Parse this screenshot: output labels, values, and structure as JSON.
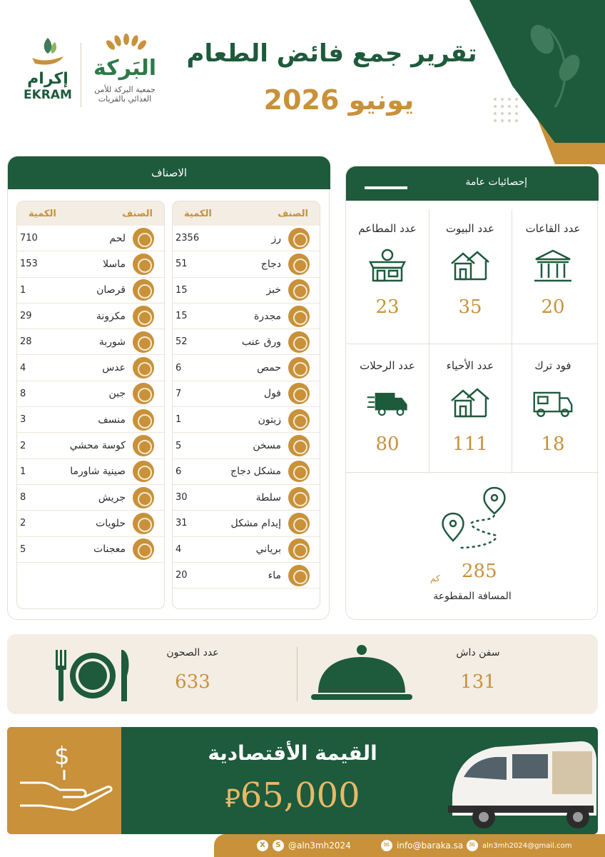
{
  "header": {
    "title": "تقرير جمع فائض الطعام",
    "date": "يونيو 2026",
    "ekram_ar": "إكرام",
    "ekram_en": "EKRAM",
    "baraka_name": "البَركة",
    "baraka_sub1": "جمعية البركة للأمن",
    "baraka_sub2": "الغذائي بالقريات"
  },
  "categories": {
    "title": "الاصناف",
    "col_item": "الصنف",
    "col_qty": "الكمية",
    "right": [
      {
        "name": "رز",
        "qty": "2356",
        "icon": "rice-icon"
      },
      {
        "name": "دجاج",
        "qty": "51",
        "icon": "chicken-icon"
      },
      {
        "name": "خبز",
        "qty": "15",
        "icon": "bread-icon"
      },
      {
        "name": "مجدرة",
        "qty": "15",
        "icon": "mujaddara-icon"
      },
      {
        "name": "ورق عنب",
        "qty": "52",
        "icon": "grape-leaves-icon"
      },
      {
        "name": "حمص",
        "qty": "6",
        "icon": "hummus-icon"
      },
      {
        "name": "فول",
        "qty": "7",
        "icon": "beans-icon"
      },
      {
        "name": "زيتون",
        "qty": "1",
        "icon": "olive-icon"
      },
      {
        "name": "مسخن",
        "qty": "5",
        "icon": "musakhan-icon"
      },
      {
        "name": "مشكل دجاج",
        "qty": "6",
        "icon": "mixed-chicken-icon"
      },
      {
        "name": "سلطة",
        "qty": "30",
        "icon": "salad-icon"
      },
      {
        "name": "إيدام مشكل",
        "qty": "31",
        "icon": "stew-icon"
      },
      {
        "name": "برياني",
        "qty": "4",
        "icon": "biryani-icon"
      },
      {
        "name": "ماء",
        "qty": "20",
        "icon": "water-icon"
      }
    ],
    "left": [
      {
        "name": "لحم",
        "qty": "710",
        "icon": "meat-icon"
      },
      {
        "name": "ماسلا",
        "qty": "153",
        "icon": "masala-icon"
      },
      {
        "name": "قرصان",
        "qty": "1",
        "icon": "qursan-icon"
      },
      {
        "name": "مكرونة",
        "qty": "29",
        "icon": "pasta-icon"
      },
      {
        "name": "شوربة",
        "qty": "28",
        "icon": "soup-icon"
      },
      {
        "name": "عدس",
        "qty": "4",
        "icon": "lentils-icon"
      },
      {
        "name": "جبن",
        "qty": "8",
        "icon": "cheese-icon"
      },
      {
        "name": "منسف",
        "qty": "3",
        "icon": "mansaf-icon"
      },
      {
        "name": "كوسة محشي",
        "qty": "2",
        "icon": "stuffed-zucchini-icon"
      },
      {
        "name": "صينية شاورما",
        "qty": "1",
        "icon": "shawarma-icon"
      },
      {
        "name": "جريش",
        "qty": "8",
        "icon": "jareesh-icon"
      },
      {
        "name": "حلويات",
        "qty": "2",
        "icon": "sweets-icon"
      },
      {
        "name": "معجنات",
        "qty": "5",
        "icon": "pastry-icon"
      }
    ]
  },
  "stats": {
    "title": "إحصائيات عامة",
    "halls_label": "عدد القاعات",
    "halls_value": "20",
    "houses_label": "عدد البيوت",
    "houses_value": "35",
    "restaurants_label": "عدد المطاعم",
    "restaurants_value": "23",
    "foodtruck_label": "فود ترك",
    "foodtruck_value": "18",
    "districts_label": "عدد الأحياء",
    "districts_value": "111",
    "trips_label": "عدد الرحلات",
    "trips_value": "80",
    "distance_value": "285",
    "distance_unit": "كم",
    "distance_label": "المسافة المقطوعة"
  },
  "plates": {
    "dishes_label": "عدد الصحون",
    "dishes_value": "633",
    "serving_label": "سفن داش",
    "serving_value": "131"
  },
  "economic": {
    "title": "القيمة الأقتصادية",
    "amount": "65,000",
    "currency": "⃁"
  },
  "footer": {
    "handle": "@aln3mh2024",
    "email1": "info@baraka.sa",
    "email2": "aln3mh2024@gmail.com"
  },
  "colors": {
    "primary": "#1e5a3c",
    "accent": "#c8913a",
    "cream": "#f3ede3"
  }
}
